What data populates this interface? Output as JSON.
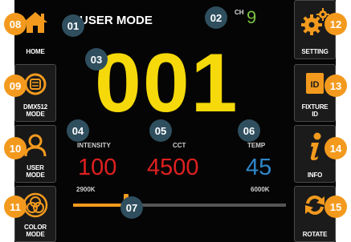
{
  "header": {
    "mode_title": "USER MODE",
    "channel_label": "CH",
    "channel_value": "9"
  },
  "display": {
    "address": "001"
  },
  "params": {
    "intensity_label": "INTENSITY",
    "intensity_value": "100",
    "cct_label": "CCT",
    "cct_value": "4500",
    "temp_label": "TEMP",
    "temp_value": "45"
  },
  "slider": {
    "min_label": "2900K",
    "max_label": "6000K",
    "level": 0.25
  },
  "left_buttons": [
    {
      "label": "HOME",
      "icon": "home-icon"
    },
    {
      "label": "DMX512 MODE",
      "icon": "dmx-icon"
    },
    {
      "label": "USER MODE",
      "icon": "user-icon"
    },
    {
      "label": "COLOR MODE",
      "icon": "color-mode-icon"
    }
  ],
  "right_buttons": [
    {
      "label": "SETTING",
      "icon": "gear-icon"
    },
    {
      "label": "FIXTURE ID",
      "icon": "id-card-icon"
    },
    {
      "label": "INFO",
      "icon": "info-icon"
    },
    {
      "label": "ROTATE",
      "icon": "rotate-icon"
    }
  ],
  "badges": [
    "01",
    "02",
    "03",
    "04",
    "05",
    "06",
    "07",
    "08",
    "09",
    "10",
    "11",
    "12",
    "13",
    "14",
    "15"
  ],
  "colors": {
    "accent": "#f39a1e",
    "address": "#f5d90a",
    "channel": "#7bc142",
    "intensity": "#e02020",
    "cct": "#e02020",
    "temp": "#2e86c9",
    "badge_dark": "#2f4f5f",
    "badge_orange": "#f39a1e"
  }
}
